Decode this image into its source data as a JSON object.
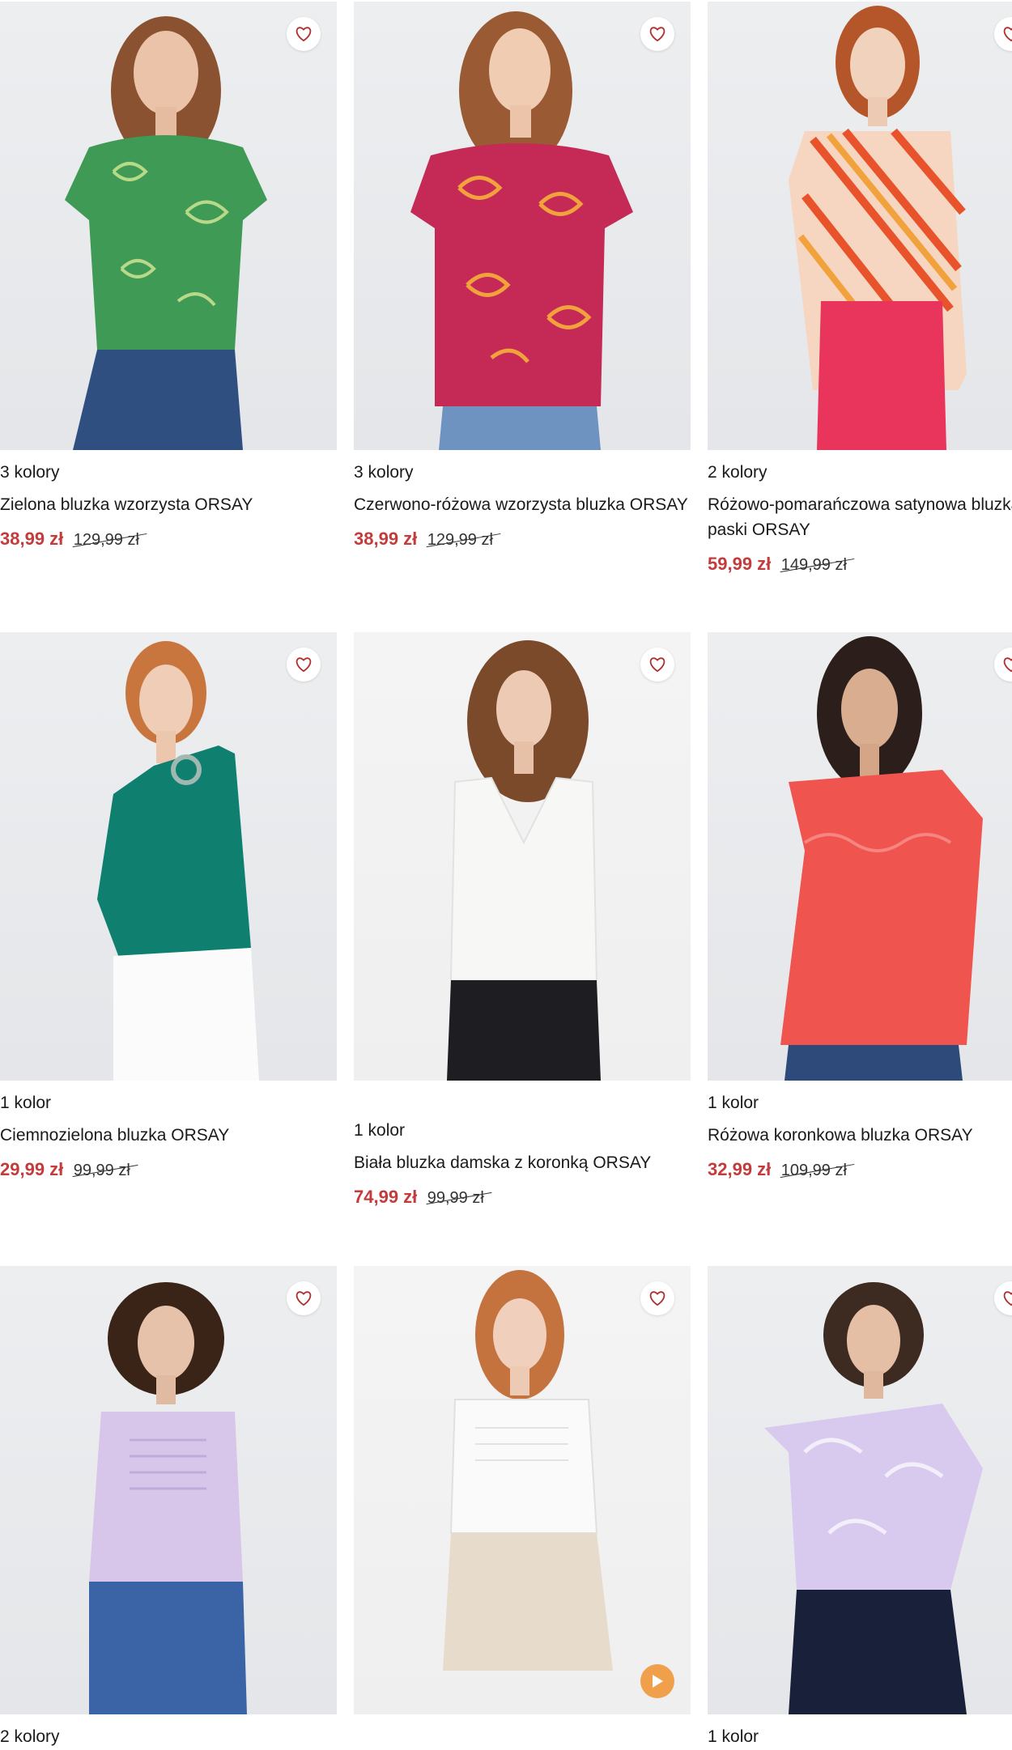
{
  "products": [
    {
      "colors": "3 kolory",
      "name": "Zielona bluzka wzorzysta ORSAY",
      "price": "38,99 zł",
      "old_price": "129,99 zł"
    },
    {
      "colors": "3 kolory",
      "name": "Czerwono-różowa wzorzysta bluzka ORSAY",
      "price": "38,99 zł",
      "old_price": "129,99 zł"
    },
    {
      "colors": "2 kolory",
      "name": "Różowo-pomarańczowa satynowa bluzka w paski ORSAY",
      "price": "59,99 zł",
      "old_price": "149,99 zł"
    },
    {
      "colors": "1 kolor",
      "name": "Ciemnozielona bluzka ORSAY",
      "price": "29,99 zł",
      "old_price": "99,99 zł"
    },
    {
      "colors": "1 kolor",
      "name": "Biała bluzka damska z koronką ORSAY",
      "price": "74,99 zł",
      "old_price": "99,99 zł"
    },
    {
      "colors": "1 kolor",
      "name": "Różowa koronkowa bluzka ORSAY",
      "price": "32,99 zł",
      "old_price": "109,99 zł"
    },
    {
      "colors": "2 kolory"
    },
    {
      "colors": ""
    },
    {
      "colors": "1 kolor"
    }
  ],
  "icons": {
    "favorite": "heart-icon",
    "video": "play-icon"
  },
  "theme": {
    "sale_color": "#c43b3b",
    "play_color": "#f0a04b",
    "heart_color": "#b03030"
  }
}
